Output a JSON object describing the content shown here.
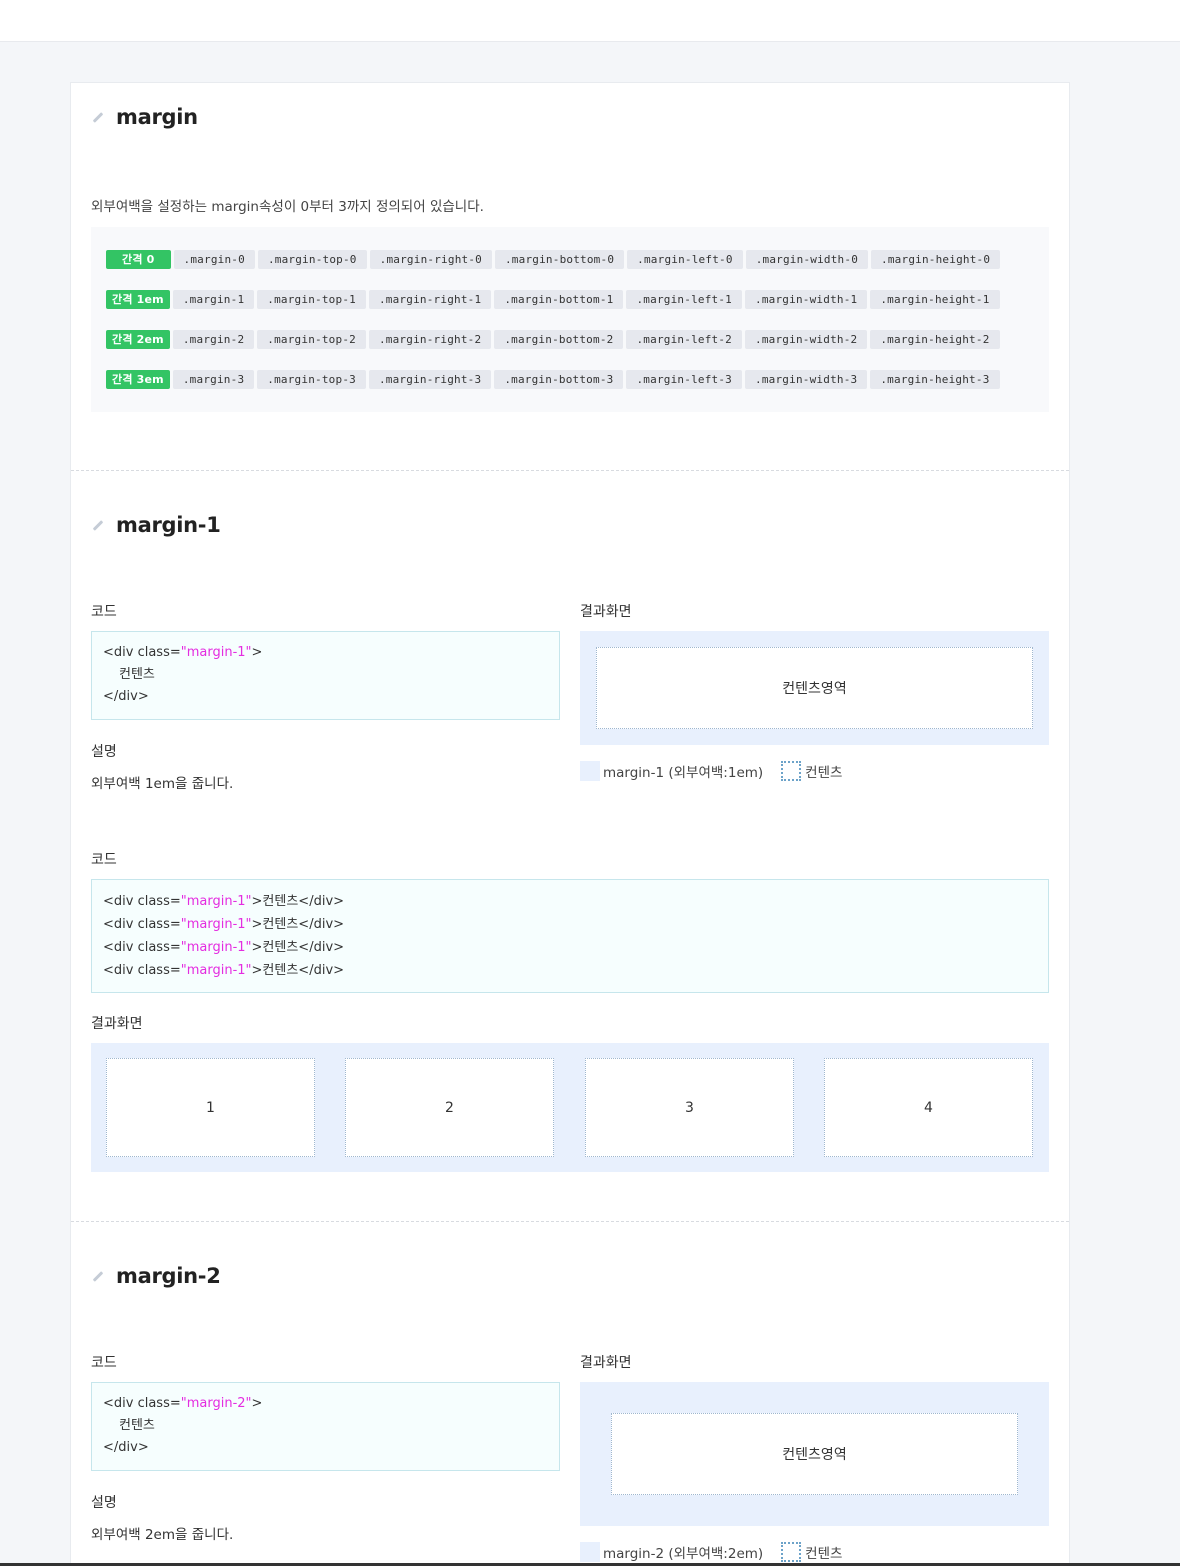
{
  "sections": {
    "margin": {
      "title": "margin",
      "description": "외부여백을 설정하는 margin속성이 0부터 3까지 정의되어 있습니다.",
      "rows": [
        {
          "badge": "간격 0",
          "tags": [
            ".margin-0",
            ".margin-top-0",
            ".margin-right-0",
            ".margin-bottom-0",
            ".margin-left-0",
            ".margin-width-0",
            ".margin-height-0"
          ]
        },
        {
          "badge": "간격 1em",
          "tags": [
            ".margin-1",
            ".margin-top-1",
            ".margin-right-1",
            ".margin-bottom-1",
            ".margin-left-1",
            ".margin-width-1",
            ".margin-height-1"
          ]
        },
        {
          "badge": "간격 2em",
          "tags": [
            ".margin-2",
            ".margin-top-2",
            ".margin-right-2",
            ".margin-bottom-2",
            ".margin-left-2",
            ".margin-width-2",
            ".margin-height-2"
          ]
        },
        {
          "badge": "간격 3em",
          "tags": [
            ".margin-3",
            ".margin-top-3",
            ".margin-right-3",
            ".margin-bottom-3",
            ".margin-left-3",
            ".margin-width-3",
            ".margin-height-3"
          ]
        }
      ]
    },
    "margin1": {
      "title": "margin-1",
      "code_label": "코드",
      "result_label": "결과화면",
      "explain_label": "설명",
      "explain_text": "외부여백 1em을 줍니다.",
      "code_open_pre": "<div class=",
      "code_attr": "\"margin-1\"",
      "code_open_post": ">",
      "code_body": "컨텐츠",
      "code_close": "</div>",
      "content_label": "컨텐츠영역",
      "legend_margin": "margin-1 (외부여백:1em)",
      "legend_content": "컨텐츠",
      "code2_label": "코드",
      "code2_lines": [
        {
          "pre": "<div class=",
          "attr": "\"margin-1\"",
          "post": ">컨텐츠</div>"
        },
        {
          "pre": "<div class=",
          "attr": "\"margin-1\"",
          "post": ">컨텐츠</div>"
        },
        {
          "pre": "<div class=",
          "attr": "\"margin-1\"",
          "post": ">컨텐츠</div>"
        },
        {
          "pre": "<div class=",
          "attr": "\"margin-1\"",
          "post": ">컨텐츠</div>"
        }
      ],
      "result2_label": "결과화면",
      "boxes": [
        "1",
        "2",
        "3",
        "4"
      ]
    },
    "margin2": {
      "title": "margin-2",
      "code_label": "코드",
      "result_label": "결과화면",
      "explain_label": "설명",
      "explain_text": "외부여백 2em을 줍니다.",
      "code_open_pre": "<div class=",
      "code_attr": "\"margin-2\"",
      "code_open_post": ">",
      "code_body": "컨텐츠",
      "code_close": "</div>",
      "content_label": "컨텐츠영역",
      "legend_margin": "margin-2 (외부여백:2em)",
      "legend_content": "컨텐츠"
    }
  }
}
